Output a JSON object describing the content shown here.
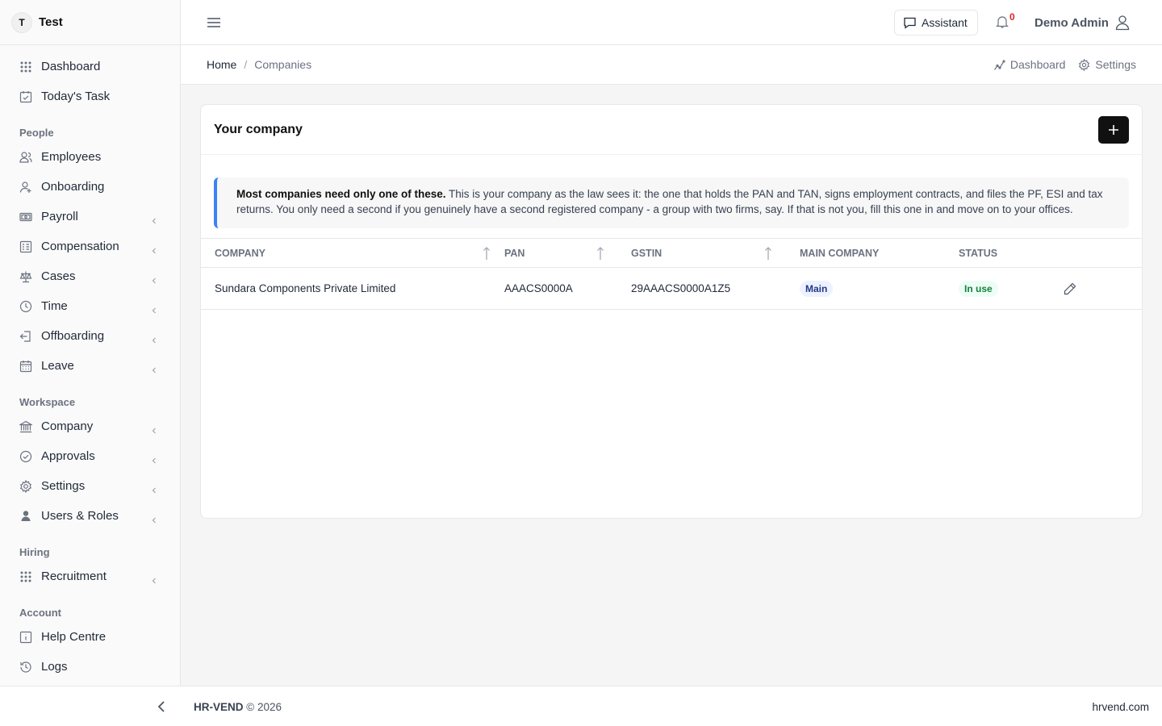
{
  "brand": {
    "initial": "T",
    "name": "Test"
  },
  "sidebar": {
    "top_items": [
      {
        "label": "Dashboard",
        "icon": "grid-icon"
      },
      {
        "label": "Today's Task",
        "icon": "calendar-check-icon"
      }
    ],
    "sections": [
      {
        "title": "People",
        "items": [
          {
            "label": "Employees",
            "icon": "users-icon",
            "chevron": false
          },
          {
            "label": "Onboarding",
            "icon": "user-plus-icon",
            "chevron": false
          },
          {
            "label": "Payroll",
            "icon": "money-icon",
            "chevron": true
          },
          {
            "label": "Compensation",
            "icon": "ledger-icon",
            "chevron": true
          },
          {
            "label": "Cases",
            "icon": "scale-icon",
            "chevron": true
          },
          {
            "label": "Time",
            "icon": "clock-icon",
            "chevron": true
          },
          {
            "label": "Offboarding",
            "icon": "exit-icon",
            "chevron": true
          },
          {
            "label": "Leave",
            "icon": "calendar-icon",
            "chevron": true
          }
        ]
      },
      {
        "title": "Workspace",
        "items": [
          {
            "label": "Company",
            "icon": "bank-icon",
            "chevron": true
          },
          {
            "label": "Approvals",
            "icon": "check-circle-icon",
            "chevron": true
          },
          {
            "label": "Settings",
            "icon": "gear-icon",
            "chevron": true
          },
          {
            "label": "Users & Roles",
            "icon": "user-shield-icon",
            "chevron": true
          }
        ]
      },
      {
        "title": "Hiring",
        "items": [
          {
            "label": "Recruitment",
            "icon": "grid-icon",
            "chevron": true
          }
        ]
      },
      {
        "title": "Account",
        "items": [
          {
            "label": "Help Centre",
            "icon": "info-icon",
            "chevron": false
          },
          {
            "label": "Logs",
            "icon": "history-icon",
            "chevron": false
          }
        ]
      }
    ]
  },
  "header": {
    "assistant_label": "Assistant",
    "notification_count": "0",
    "user_name": "Demo Admin"
  },
  "breadcrumb": {
    "home": "Home",
    "separator": "/",
    "current": "Companies",
    "actions": {
      "dashboard": "Dashboard",
      "settings": "Settings"
    }
  },
  "card": {
    "title": "Your company",
    "notice_bold": "Most companies need only one of these.",
    "notice_text": " This is your company as the law sees it: the one that holds the PAN and TAN, signs employment contracts, and files the PF, ESI and tax returns. You only need a second if you genuinely have a second registered company - a group with two firms, say. If that is not you, fill this one in and move on to your offices."
  },
  "table": {
    "columns": [
      "COMPANY",
      "PAN",
      "GSTIN",
      "MAIN COMPANY",
      "STATUS"
    ],
    "rows": [
      {
        "company": "Sundara Components Private Limited",
        "pan": "AAACS0000A",
        "gstin": "29AAACS0000A1Z5",
        "main": "Main",
        "status": "In use"
      }
    ]
  },
  "footer": {
    "brand": "HR-VEND",
    "copyright": "© 2026",
    "site": "hrvend.com"
  }
}
